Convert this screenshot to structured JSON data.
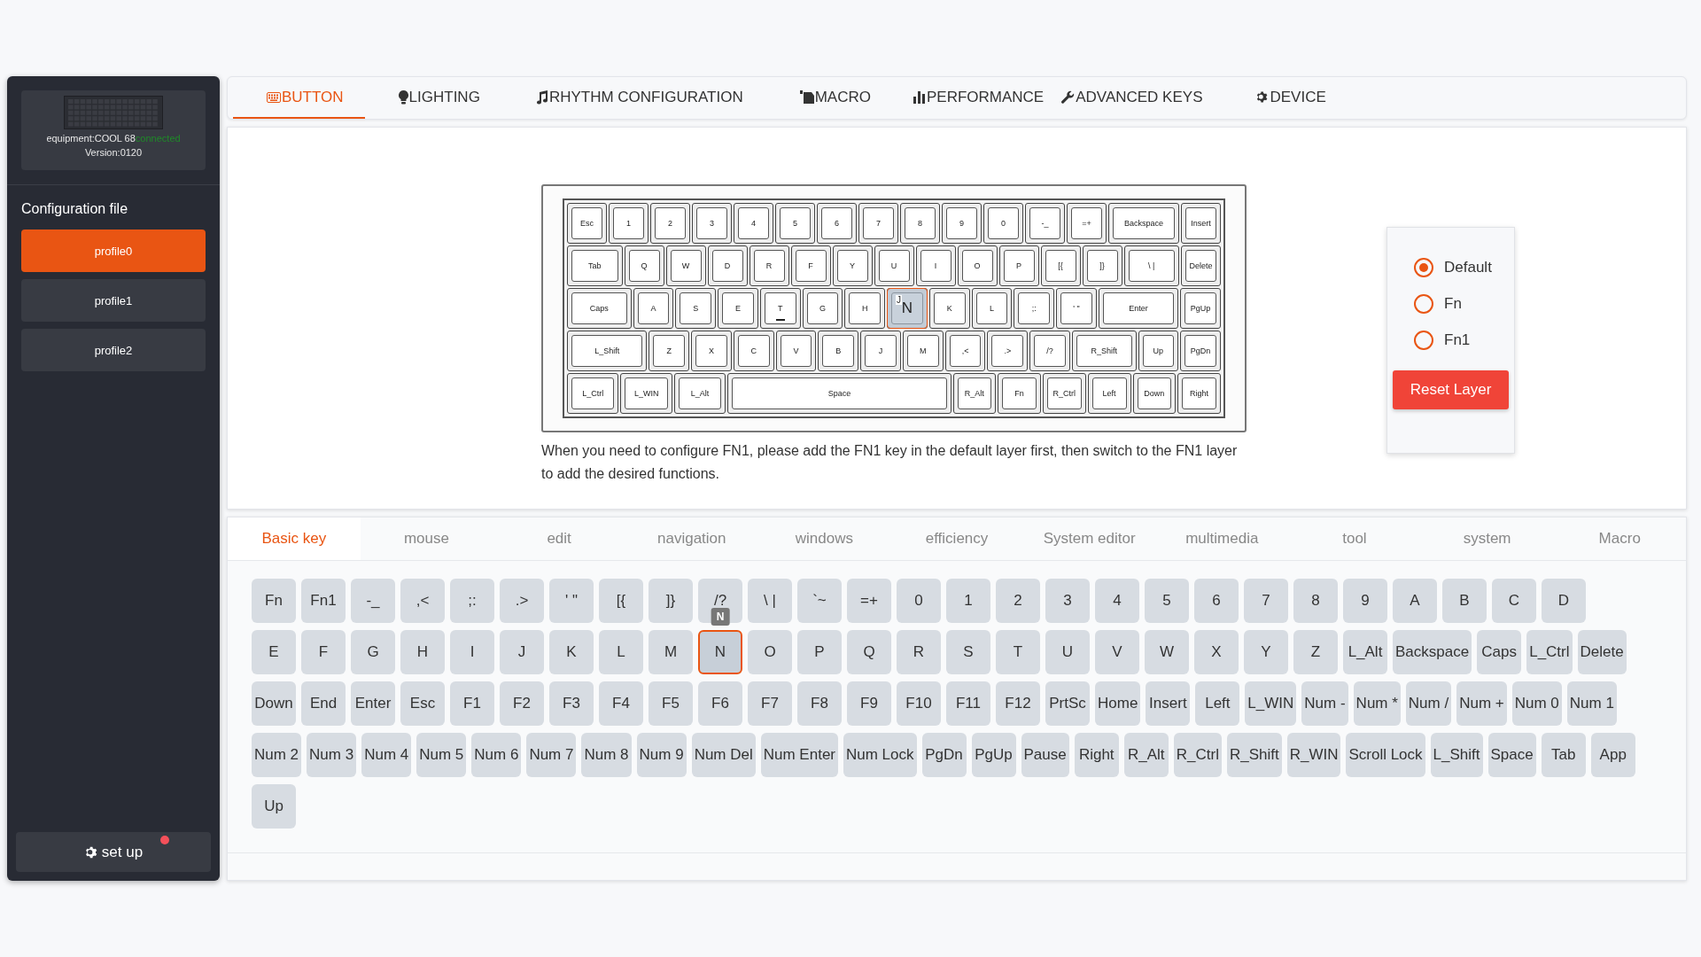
{
  "sidebar": {
    "device": {
      "equipment": "equipment:COOL 68",
      "status": "connected",
      "connected": true,
      "version": "Version:0120"
    },
    "section_title": "Configuration file",
    "profiles": [
      {
        "label": "profile0",
        "selected": true
      },
      {
        "label": "profile1",
        "selected": false
      },
      {
        "label": "profile2",
        "selected": false
      }
    ],
    "setup_button": {
      "label": "set up",
      "notification": true
    }
  },
  "tabs": [
    {
      "label": "BUTTON",
      "selected": true
    },
    {
      "label": "LIGHTING",
      "selected": false
    },
    {
      "label": "RHYTHM CONFIGURATION",
      "selected": false
    },
    {
      "label": "MACRO",
      "selected": false
    },
    {
      "label": "PERFORMANCE",
      "selected": false
    },
    {
      "label": "ADVANCED KEYS",
      "selected": false
    },
    {
      "label": "DEVICE",
      "selected": false
    }
  ],
  "keyboard": {
    "rows": [
      {
        "keys": [
          {
            "label": "Esc"
          },
          {
            "label": "1"
          },
          {
            "label": "2"
          },
          {
            "label": "3"
          },
          {
            "label": "4"
          },
          {
            "label": "5"
          },
          {
            "label": "6"
          },
          {
            "label": "7"
          },
          {
            "label": "8"
          },
          {
            "label": "9"
          },
          {
            "label": "0"
          },
          {
            "label": "-_"
          },
          {
            "label": "=+"
          },
          {
            "label": "Backspace"
          },
          {
            "label": "Insert"
          }
        ]
      },
      {
        "keys": [
          {
            "label": "Tab"
          },
          {
            "label": "Q"
          },
          {
            "label": "W"
          },
          {
            "label": "D"
          },
          {
            "label": "R"
          },
          {
            "label": "F"
          },
          {
            "label": "Y"
          },
          {
            "label": "U"
          },
          {
            "label": "I"
          },
          {
            "label": "O"
          },
          {
            "label": "P"
          },
          {
            "label": "[{"
          },
          {
            "label": "]}"
          },
          {
            "label": "\\ |"
          },
          {
            "label": "Delete"
          }
        ]
      },
      {
        "keys": [
          {
            "label": "Caps"
          },
          {
            "label": "A"
          },
          {
            "label": "S"
          },
          {
            "label": "E"
          },
          {
            "label": "T",
            "cursor": true
          },
          {
            "label": "G"
          },
          {
            "label": "H"
          },
          {
            "label": "J",
            "highlighted": true,
            "overlay": "N"
          },
          {
            "label": "K"
          },
          {
            "label": "L"
          },
          {
            "label": ";:"
          },
          {
            "label": "' \""
          },
          {
            "label": "Enter"
          },
          {
            "label": "PgUp"
          }
        ]
      },
      {
        "keys": [
          {
            "label": "L_Shift"
          },
          {
            "label": "Z"
          },
          {
            "label": "X"
          },
          {
            "label": "C"
          },
          {
            "label": "V"
          },
          {
            "label": "B"
          },
          {
            "label": "J"
          },
          {
            "label": "M"
          },
          {
            "label": ",<"
          },
          {
            "label": ".>"
          },
          {
            "label": "/?"
          },
          {
            "label": "R_Shift"
          },
          {
            "label": "Up"
          },
          {
            "label": "PgDn"
          }
        ]
      },
      {
        "keys": [
          {
            "label": "L_Ctrl"
          },
          {
            "label": "L_WIN"
          },
          {
            "label": "L_Alt"
          },
          {
            "label": "Space"
          },
          {
            "label": "R_Alt"
          },
          {
            "label": "Fn"
          },
          {
            "label": "R_Ctrl"
          },
          {
            "label": "Left"
          },
          {
            "label": "Down"
          },
          {
            "label": "Right"
          }
        ]
      }
    ],
    "note": "When you need to configure FN1, please add the FN1 key in the default layer first, then switch to the FN1 layer to add the desired functions."
  },
  "layers": {
    "options": [
      {
        "label": "Default",
        "selected": true
      },
      {
        "label": "Fn",
        "selected": false
      },
      {
        "label": "Fn1",
        "selected": false
      }
    ],
    "reset_button": "Reset Layer"
  },
  "key_categories": [
    {
      "label": "Basic key",
      "selected": true
    },
    {
      "label": "mouse",
      "selected": false
    },
    {
      "label": "edit",
      "selected": false
    },
    {
      "label": "navigation",
      "selected": false
    },
    {
      "label": "windows",
      "selected": false
    },
    {
      "label": "efficiency",
      "selected": false
    },
    {
      "label": "System editor",
      "selected": false
    },
    {
      "label": "multimedia",
      "selected": false
    },
    {
      "label": "tool",
      "selected": false
    },
    {
      "label": "system",
      "selected": false
    },
    {
      "label": "Macro",
      "selected": false
    }
  ],
  "key_rows": [
    [
      {
        "label": "Fn",
        "selected": false
      },
      {
        "label": "Fn1",
        "selected": false
      },
      {
        "label": "-_",
        "selected": false
      },
      {
        "label": ",<",
        "selected": false
      },
      {
        "label": ";:",
        "selected": false
      },
      {
        "label": ".>",
        "selected": false
      },
      {
        "label": "' \"",
        "selected": false
      },
      {
        "label": "[{",
        "selected": false
      },
      {
        "label": "]}",
        "selected": false
      },
      {
        "label": "/?",
        "selected": false
      },
      {
        "label": "\\ |",
        "selected": false
      },
      {
        "label": "`~",
        "selected": false
      },
      {
        "label": "=+",
        "selected": false
      },
      {
        "label": "0",
        "selected": false
      },
      {
        "label": "1",
        "selected": false
      },
      {
        "label": "2",
        "selected": false
      },
      {
        "label": "3",
        "selected": false
      },
      {
        "label": "4",
        "selected": false
      },
      {
        "label": "5",
        "selected": false
      },
      {
        "label": "6",
        "selected": false
      },
      {
        "label": "7",
        "selected": false
      },
      {
        "label": "8",
        "selected": false
      },
      {
        "label": "9",
        "selected": false
      },
      {
        "label": "A",
        "selected": false
      },
      {
        "label": "B",
        "selected": false
      },
      {
        "label": "C",
        "selected": false
      },
      {
        "label": "D",
        "selected": false
      }
    ],
    [
      {
        "label": "E",
        "selected": false
      },
      {
        "label": "F",
        "selected": false
      },
      {
        "label": "G",
        "selected": false
      },
      {
        "label": "H",
        "selected": false
      },
      {
        "label": "I",
        "selected": false
      },
      {
        "label": "J",
        "selected": false
      },
      {
        "label": "K",
        "selected": false
      },
      {
        "label": "L",
        "selected": false
      },
      {
        "label": "M",
        "selected": false
      },
      {
        "label": "N",
        "selected": true,
        "tooltip": "N"
      },
      {
        "label": "O",
        "selected": false
      },
      {
        "label": "P",
        "selected": false
      },
      {
        "label": "Q",
        "selected": false
      },
      {
        "label": "R",
        "selected": false
      },
      {
        "label": "S",
        "selected": false
      },
      {
        "label": "T",
        "selected": false
      },
      {
        "label": "U",
        "selected": false
      },
      {
        "label": "V",
        "selected": false
      },
      {
        "label": "W",
        "selected": false
      },
      {
        "label": "X",
        "selected": false
      },
      {
        "label": "Y",
        "selected": false
      },
      {
        "label": "Z",
        "selected": false
      },
      {
        "label": "L_Alt",
        "selected": false
      },
      {
        "label": "Backspace",
        "selected": false
      },
      {
        "label": "Caps",
        "selected": false
      },
      {
        "label": "L_Ctrl",
        "selected": false
      },
      {
        "label": "Delete",
        "selected": false
      }
    ],
    [
      {
        "label": "Down",
        "selected": false
      },
      {
        "label": "End",
        "selected": false
      },
      {
        "label": "Enter",
        "selected": false
      },
      {
        "label": "Esc",
        "selected": false
      },
      {
        "label": "F1",
        "selected": false
      },
      {
        "label": "F2",
        "selected": false
      },
      {
        "label": "F3",
        "selected": false
      },
      {
        "label": "F4",
        "selected": false
      },
      {
        "label": "F5",
        "selected": false
      },
      {
        "label": "F6",
        "selected": false
      },
      {
        "label": "F7",
        "selected": false
      },
      {
        "label": "F8",
        "selected": false
      },
      {
        "label": "F9",
        "selected": false
      },
      {
        "label": "F10",
        "selected": false
      },
      {
        "label": "F11",
        "selected": false
      },
      {
        "label": "F12",
        "selected": false
      },
      {
        "label": "PrtSc",
        "selected": false
      },
      {
        "label": "Home",
        "selected": false
      },
      {
        "label": "Insert",
        "selected": false
      },
      {
        "label": "Left",
        "selected": false
      },
      {
        "label": "L_WIN",
        "selected": false
      },
      {
        "label": "Num -",
        "selected": false
      },
      {
        "label": "Num *",
        "selected": false
      },
      {
        "label": "Num /",
        "selected": false
      },
      {
        "label": "Num +",
        "selected": false
      },
      {
        "label": "Num 0",
        "selected": false
      },
      {
        "label": "Num 1",
        "selected": false
      }
    ],
    [
      {
        "label": "Num 2",
        "selected": false
      },
      {
        "label": "Num 3",
        "selected": false
      },
      {
        "label": "Num 4",
        "selected": false
      },
      {
        "label": "Num 5",
        "selected": false
      },
      {
        "label": "Num 6",
        "selected": false
      },
      {
        "label": "Num 7",
        "selected": false
      },
      {
        "label": "Num 8",
        "selected": false
      },
      {
        "label": "Num 9",
        "selected": false
      },
      {
        "label": "Num Del",
        "selected": false
      },
      {
        "label": "Num Enter",
        "selected": false
      },
      {
        "label": "Num Lock",
        "selected": false
      },
      {
        "label": "PgDn",
        "selected": false
      },
      {
        "label": "PgUp",
        "selected": false
      },
      {
        "label": "Pause",
        "selected": false
      },
      {
        "label": "Right",
        "selected": false
      },
      {
        "label": "R_Alt",
        "selected": false
      },
      {
        "label": "R_Ctrl",
        "selected": false
      },
      {
        "label": "R_Shift",
        "selected": false
      },
      {
        "label": "R_WIN",
        "selected": false
      },
      {
        "label": "Scroll Lock",
        "selected": false
      },
      {
        "label": "L_Shift",
        "selected": false
      },
      {
        "label": "Space",
        "selected": false
      },
      {
        "label": "Tab",
        "selected": false
      },
      {
        "label": "App",
        "selected": false
      }
    ],
    [
      {
        "label": "Up",
        "selected": false
      }
    ]
  ]
}
